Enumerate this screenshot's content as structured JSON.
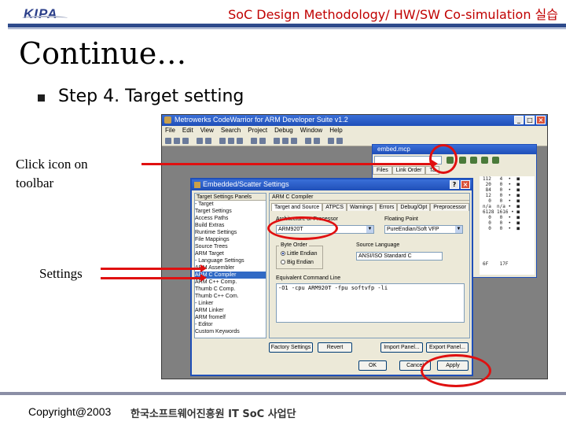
{
  "header": {
    "logo_text": "KIPA",
    "title": "SoC Design Methodology/ HW/SW Co-simulation 실습"
  },
  "slide": {
    "title": "Continue…",
    "bullet": "Step 4. Target setting"
  },
  "annotations": {
    "click_icon": "Click icon on toolbar",
    "settings": "Settings"
  },
  "footer": {
    "copyright": "Copyright@2003",
    "org": "한국소프트웨어진흥원 IT SoC 사업단"
  },
  "colors": {
    "accent": "#2f4b8c",
    "header_red": "#c00000",
    "annotation_red": "#e01010",
    "xp_blue": "#1f4fb8"
  },
  "screenshot": {
    "window_title": "Metrowerks CodeWarrior for ARM Developer Suite v1.2",
    "menu": [
      "File",
      "Edit",
      "View",
      "Search",
      "Project",
      "Debug",
      "Window",
      "Help"
    ],
    "project_window": {
      "title": "embed.mcp",
      "tabs": [
        "Files",
        "Link Order",
        "Ta"
      ],
      "rows": [
        "112   4  •  ■",
        " 20   0  •  ■",
        " 84   0  •  ■",
        " 12   0  •  ■",
        "  0   0  •  ■",
        "n/a  n/a •  ■",
        "6128 1616 • ■",
        "  0   0  •  ■",
        "  0   0  •  ■",
        "  0   0  •  ■"
      ],
      "status": "6F    17F"
    },
    "settings_dialog": {
      "title": "Embedded/Scatter Settings",
      "tree_header": "Target Settings Panels",
      "tree_items": [
        "- Target",
        "   Target Settings",
        "   Access Paths",
        "   Build Extras",
        "   Runtime Settings",
        "   File Mappings",
        "   Source Trees",
        "   ARM Target",
        "- Language Settings",
        "   ARM Assembler",
        "   ARM C Compiler",
        "   ARM C++ Comp.",
        "   Thumb C Comp.",
        "   Thumb C++ Com.",
        "- Linker",
        "   ARM Linker",
        "   ARM fromelf",
        "- Editor",
        "   Custom Keywords"
      ],
      "selected_tree_item": "   ARM C Compiler",
      "panel_header": "ARM C Compiler",
      "tabs": [
        "Target and Source",
        "ATPCS",
        "Warnings",
        "Errors",
        "Debug/Opt",
        "Preprocessor"
      ],
      "architecture_label": "Architecture or Processor",
      "architecture_value": "ARM920T",
      "float_label": "Floating Point",
      "float_value": "PureEndian/Soft VFP",
      "byte_order_label": "Byte Order",
      "byte_order_options": [
        "Little Endian",
        "Big Endian"
      ],
      "byte_order_selected": "Little Endian",
      "source_label": "Source Language",
      "source_value": "ANSI/ISO Standard C",
      "cmdline_label": "Equivalent Command Line",
      "cmdline_value": "-O1 -cpu ARM920T -fpu softvfp -li",
      "buttons": {
        "factory": "Factory Settings",
        "revert": "Revert",
        "import": "Import Panel...",
        "export": "Export Panel...",
        "ok": "OK",
        "cancel": "Cancel",
        "apply": "Apply"
      }
    }
  }
}
